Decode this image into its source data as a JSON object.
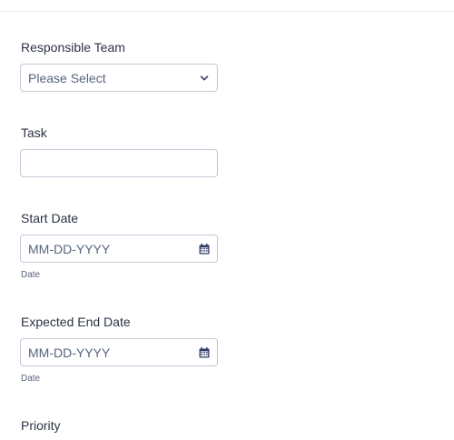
{
  "form": {
    "responsible_team": {
      "label": "Responsible Team",
      "selected": "Please Select"
    },
    "task": {
      "label": "Task",
      "value": ""
    },
    "start_date": {
      "label": "Start Date",
      "placeholder": "MM-DD-YYYY",
      "sublabel": "Date"
    },
    "expected_end_date": {
      "label": "Expected End Date",
      "placeholder": "MM-DD-YYYY",
      "sublabel": "Date"
    },
    "priority": {
      "label": "Priority"
    }
  },
  "icons": {
    "dropdown": "chevron-down-icon",
    "date_picker": "calendar-icon"
  },
  "colors": {
    "label_text": "#2c3345",
    "placeholder_text": "#57647e",
    "input_border": "#c3cad8",
    "icon": "#343c6a"
  }
}
